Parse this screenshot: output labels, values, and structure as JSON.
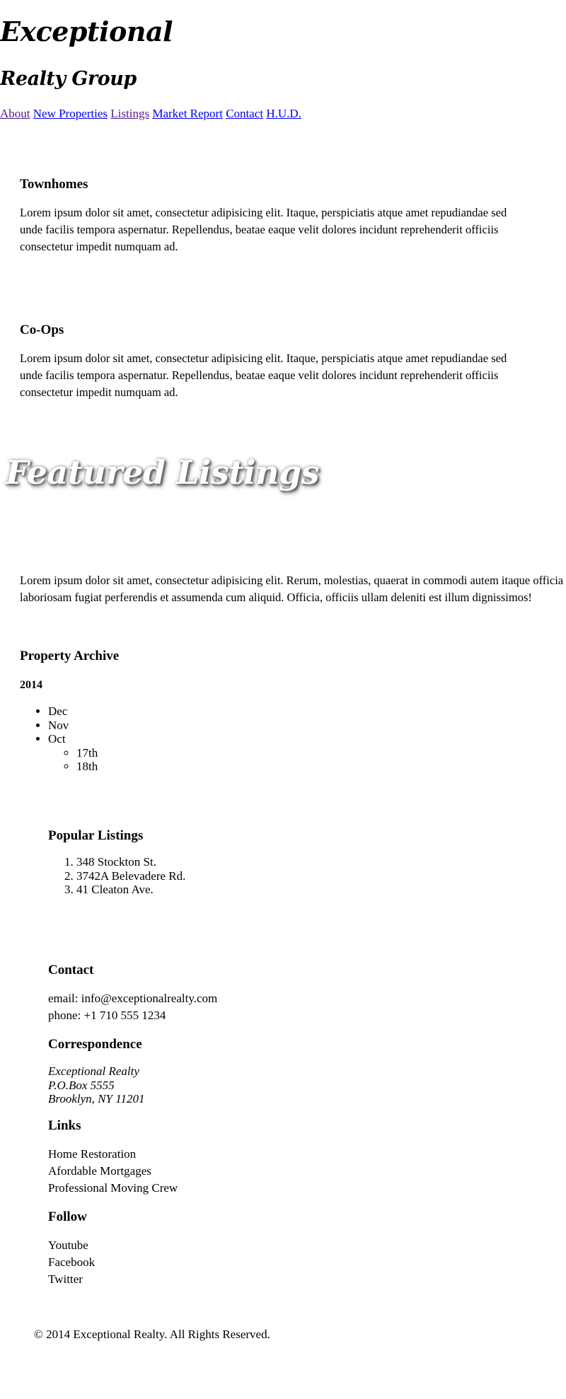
{
  "brand": {
    "line1": "Exceptional",
    "line2": "Realty Group"
  },
  "nav": {
    "items": [
      {
        "label": "About"
      },
      {
        "label": "New Properties"
      },
      {
        "label": "Listings"
      },
      {
        "label": "Market Report"
      },
      {
        "label": "Contact"
      },
      {
        "label": "H.U.D."
      }
    ]
  },
  "sections": {
    "townhomes": {
      "heading": "Townhomes",
      "text": "Lorem ipsum dolor sit amet, consectetur adipisicing elit. Itaque, perspiciatis atque amet repudiandae sed unde facilis tempora aspernatur. Repellendus, beatae eaque velit dolores incidunt reprehenderit officiis consectetur impedit numquam ad."
    },
    "coops": {
      "heading": "Co-Ops",
      "text": "Lorem ipsum dolor sit amet, consectetur adipisicing elit. Itaque, perspiciatis atque amet repudiandae sed unde facilis tempora aspernatur. Repellendus, beatae eaque velit dolores incidunt reprehenderit officiis consectetur impedit numquam ad."
    }
  },
  "featured": {
    "title": "Featured Listings",
    "text": "Lorem ipsum dolor sit amet, consectetur adipisicing elit. Rerum, molestias, quaerat in commodi autem itaque officia laboriosam fugiat perferendis et assumenda cum aliquid. Officia, officiis ullam deleniti est illum dignissimos!"
  },
  "archive": {
    "heading": "Property Archive",
    "year": "2014",
    "months": [
      "Dec",
      "Nov",
      "Oct"
    ],
    "oct_days": [
      "17th",
      "18th"
    ]
  },
  "popular": {
    "heading": "Popular Listings",
    "items": [
      "348 Stockton St.",
      "3742A Belevadere Rd.",
      "41 Cleaton Ave."
    ]
  },
  "contact": {
    "heading": "Contact",
    "email": "email: info@exceptionalrealty.com",
    "phone": "phone: +1 710 555 1234"
  },
  "correspondence": {
    "heading": "Correspondence",
    "lines": [
      "Exceptional Realty",
      "P.O.Box 5555",
      "Brooklyn, NY 11201"
    ]
  },
  "links": {
    "heading": "Links",
    "items": [
      "Home Restoration",
      "Afordable Mortgages",
      "Professional Moving Crew"
    ]
  },
  "follow": {
    "heading": "Follow",
    "items": [
      "Youtube",
      "Facebook",
      "Twitter"
    ]
  },
  "footer": {
    "copyright": "© 2014 Exceptional Realty. All Rights Reserved."
  },
  "colors": {
    "link": "#0000ee",
    "visited_link": "#551a8b",
    "text": "#000000",
    "background": "#ffffff"
  }
}
